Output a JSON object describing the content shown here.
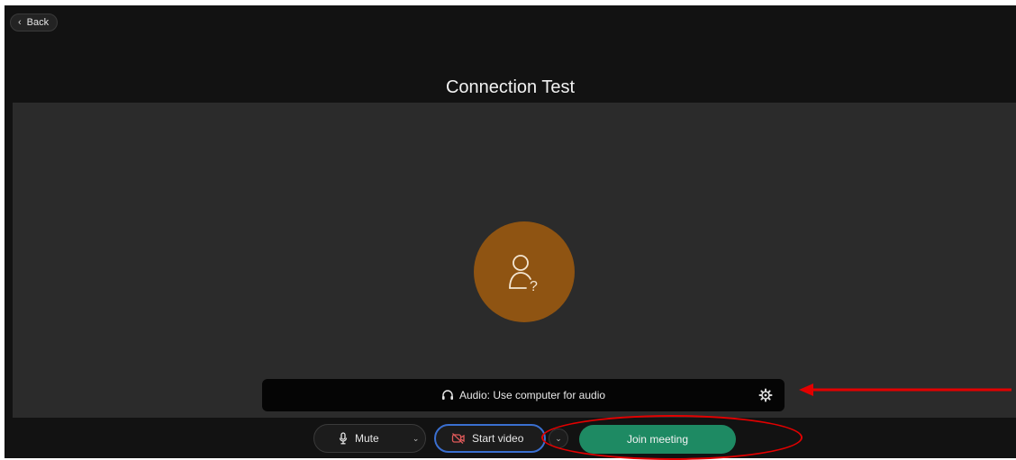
{
  "nav": {
    "back_label": "Back"
  },
  "page": {
    "title": "Connection Test"
  },
  "audio": {
    "label": "Audio: Use computer for audio"
  },
  "controls": {
    "mute_label": "Mute",
    "video_label": "Start video",
    "join_label": "Join meeting"
  },
  "icons": {
    "back": "chevron-left-icon",
    "avatar": "unknown-user-icon",
    "headset": "headset-icon",
    "settings": "gear-icon",
    "mic": "microphone-icon",
    "video_off": "video-off-icon",
    "dropdown": "chevron-down-icon"
  },
  "colors": {
    "background": "#121212",
    "preview": "#2b2b2b",
    "avatar": "#8f5412",
    "join": "#1e8a63",
    "video_focus": "#3a6fd0",
    "video_off_icon": "#e05a5a",
    "annotation": "#e30000"
  }
}
